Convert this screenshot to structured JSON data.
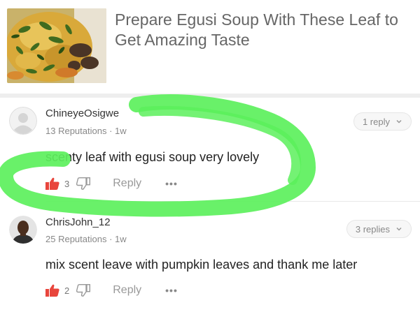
{
  "article": {
    "title": "Prepare Egusi Soup With These Leaf to Get Amazing Taste",
    "thumbnail_alt": "egusi soup dish"
  },
  "comments": [
    {
      "username": "ChineyeOsigwe",
      "reputation": "13 Reputations",
      "separator": "·",
      "time": "1w",
      "replies_label": "1 reply",
      "text": "scenty leaf with egusi soup very lovely",
      "likes": "3",
      "reply_label": "Reply",
      "more_label": "•••",
      "avatar": "default-avatar"
    },
    {
      "username": "ChrisJohn_12",
      "reputation": "25 Reputations",
      "separator": "·",
      "time": "1w",
      "replies_label": "3 replies",
      "text": "mix scent leave with pumpkin leaves and thank me later",
      "likes": "2",
      "reply_label": "Reply",
      "more_label": "•••",
      "avatar": "user-photo"
    }
  ],
  "colors": {
    "like_red": "#e8453c",
    "highlight_green": "#5cf05c",
    "title_gray": "#666666"
  },
  "icons": [
    "thumbs-up-icon",
    "thumbs-down-icon",
    "chevron-down-icon",
    "more-icon",
    "avatar-icon"
  ]
}
